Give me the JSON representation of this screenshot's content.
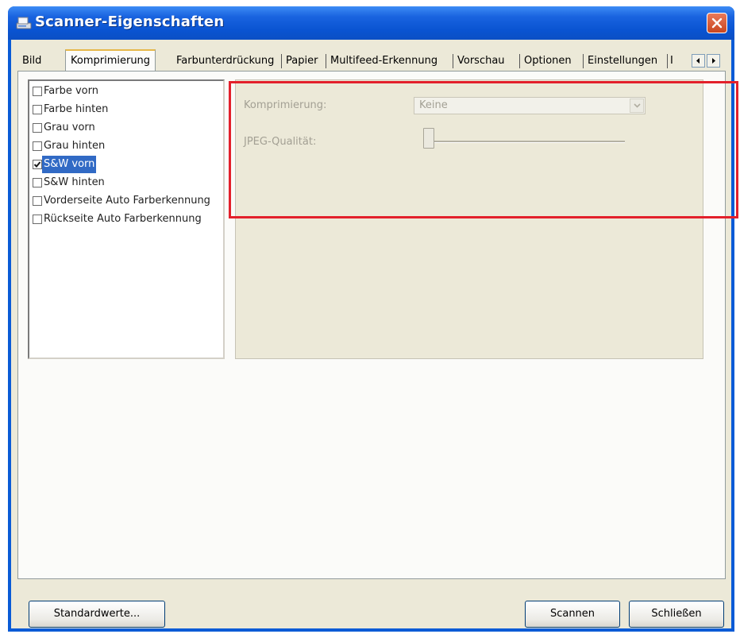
{
  "window": {
    "title": "Scanner-Eigenschaften"
  },
  "tabs": [
    {
      "label": "Bild",
      "active": false
    },
    {
      "label": "Komprimierung",
      "active": true
    },
    {
      "label": "Farbunterdrückung",
      "active": false
    },
    {
      "label": "Papier",
      "active": false
    },
    {
      "label": "Multifeed-Erkennung",
      "active": false
    },
    {
      "label": "Vorschau",
      "active": false
    },
    {
      "label": "Optionen",
      "active": false
    },
    {
      "label": "Einstellungen",
      "active": false
    },
    {
      "label": "I",
      "active": false
    }
  ],
  "image_list": [
    {
      "label": "Farbe vorn",
      "checked": false,
      "selected": false
    },
    {
      "label": "Farbe hinten",
      "checked": false,
      "selected": false
    },
    {
      "label": "Grau vorn",
      "checked": false,
      "selected": false
    },
    {
      "label": "Grau hinten",
      "checked": false,
      "selected": false
    },
    {
      "label": "S&W vorn",
      "checked": true,
      "selected": true
    },
    {
      "label": "S&W hinten",
      "checked": false,
      "selected": false
    },
    {
      "label": "Vorderseite Auto Farberkennung",
      "checked": false,
      "selected": false
    },
    {
      "label": "Rückseite Auto Farberkennung",
      "checked": false,
      "selected": false
    }
  ],
  "settings": {
    "compression_label": "Komprimierung:",
    "compression_value": "Keine",
    "jpeg_quality_label": "JPEG-Qualität:",
    "jpeg_quality_level": 0,
    "disabled": true
  },
  "buttons": {
    "defaults": "Standardwerte...",
    "scan": "Scannen",
    "close": "Schließen"
  },
  "colors": {
    "titlebar": "#0a54d2",
    "selection": "#316ac5",
    "annotation": "#e3202b",
    "dialog_bg": "#ece9d8"
  }
}
